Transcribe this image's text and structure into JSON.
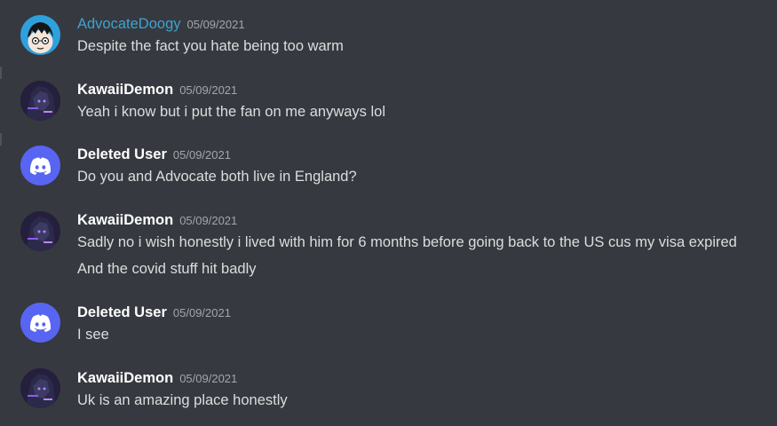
{
  "colors": {
    "background": "#36393f",
    "username_default": "#ffffff",
    "username_advocate": "#3fa3d1",
    "timestamp": "#a3a6aa",
    "message_text": "#dcddde",
    "discord_blurple": "#5865f2"
  },
  "messages": [
    {
      "author": "AdvocateDoogy",
      "timestamp": "05/09/2021",
      "avatar_icon": "cartoon-boy-avatar-icon",
      "lines": [
        "Despite the fact you hate being too warm"
      ]
    },
    {
      "author": "KawaiiDemon",
      "timestamp": "05/09/2021",
      "avatar_icon": "dark-anime-avatar-icon",
      "lines": [
        "Yeah i know but i put the fan on me anyways lol"
      ]
    },
    {
      "author": "Deleted User",
      "timestamp": "05/09/2021",
      "avatar_icon": "discord-logo-icon",
      "lines": [
        "Do you and Advocate both live in England?"
      ]
    },
    {
      "author": "KawaiiDemon",
      "timestamp": "05/09/2021",
      "avatar_icon": "dark-anime-avatar-icon",
      "lines": [
        "Sadly no i wish honestly i lived with him for 6 months before going back to the US cus my visa expired",
        "And the covid stuff hit badly"
      ]
    },
    {
      "author": "Deleted User",
      "timestamp": "05/09/2021",
      "avatar_icon": "discord-logo-icon",
      "lines": [
        "I see"
      ]
    },
    {
      "author": "KawaiiDemon",
      "timestamp": "05/09/2021",
      "avatar_icon": "dark-anime-avatar-icon",
      "lines": [
        "Uk is an amazing place honestly"
      ]
    }
  ]
}
